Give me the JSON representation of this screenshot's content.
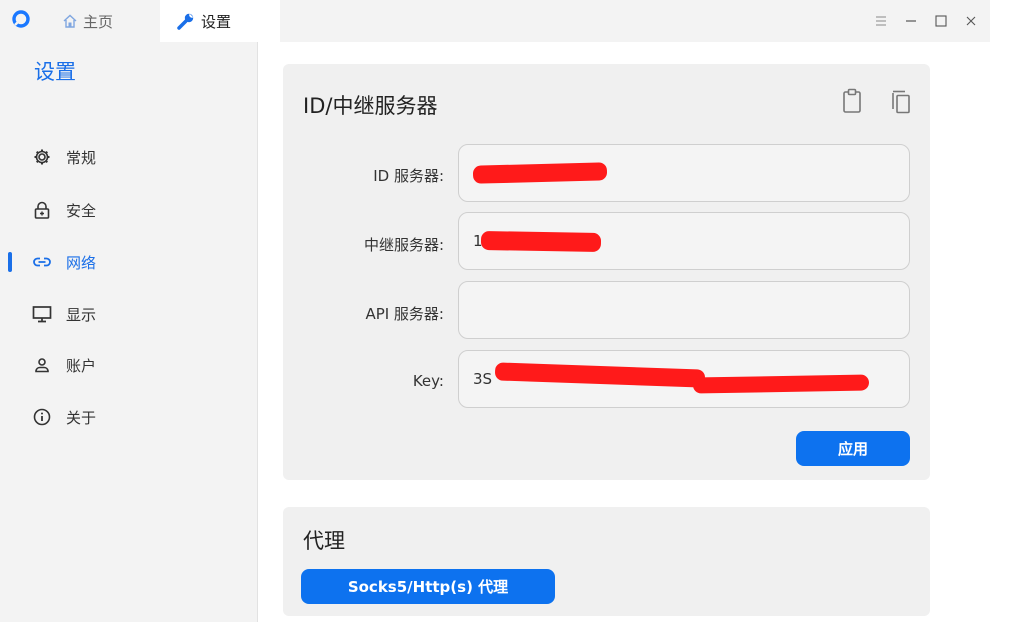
{
  "titlebar": {
    "tabs": [
      {
        "label": "主页",
        "icon": "home-icon"
      },
      {
        "label": "设置",
        "icon": "wrench-icon"
      }
    ],
    "controls": [
      "menu-icon",
      "minimize-icon",
      "maximize-icon",
      "close-icon"
    ]
  },
  "sidebar": {
    "title": "设置",
    "items": [
      {
        "label": "常规",
        "icon": "gear-icon",
        "active": false
      },
      {
        "label": "安全",
        "icon": "lock-icon",
        "active": false
      },
      {
        "label": "网络",
        "icon": "link-icon",
        "active": true
      },
      {
        "label": "显示",
        "icon": "monitor-icon",
        "active": false
      },
      {
        "label": "账户",
        "icon": "user-icon",
        "active": false
      },
      {
        "label": "关于",
        "icon": "info-icon",
        "active": false
      }
    ]
  },
  "id_relay": {
    "title": "ID/中继服务器",
    "fields": [
      {
        "label": "ID 服务器:",
        "value": ""
      },
      {
        "label": "中继服务器:",
        "value": "1"
      },
      {
        "label": "API 服务器:",
        "value": ""
      },
      {
        "label": "Key:",
        "value": "3S"
      }
    ],
    "apply_label": "应用"
  },
  "proxy": {
    "title": "代理",
    "button_label": "Socks5/Http(s) 代理"
  },
  "colors": {
    "accent": "#1a6fe8",
    "button": "#0d72ef",
    "redaction": "#ff1a1a"
  }
}
